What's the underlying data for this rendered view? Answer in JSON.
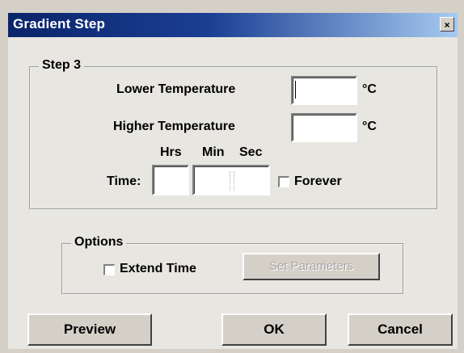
{
  "window": {
    "title": "Gradient Step",
    "close_label": "×"
  },
  "step": {
    "group_label": "Step 3",
    "lower_temp_label": "Lower Temperature",
    "lower_temp_value": "",
    "lower_temp_unit": "°C",
    "higher_temp_label": "Higher Temperature",
    "higher_temp_value": "",
    "higher_temp_unit": "°C",
    "time_label": "Time:",
    "hrs_label": "Hrs",
    "min_label": "Min",
    "sec_label": "Sec",
    "hrs_value": "",
    "minsec_value": "",
    "forever_label": "Forever",
    "forever_checked": false
  },
  "options": {
    "group_label": "Options",
    "extend_time_label": "Extend Time",
    "extend_time_checked": false,
    "set_parameters_label": "Set Parameters"
  },
  "buttons": {
    "preview": "Preview",
    "ok": "OK",
    "cancel": "Cancel"
  }
}
